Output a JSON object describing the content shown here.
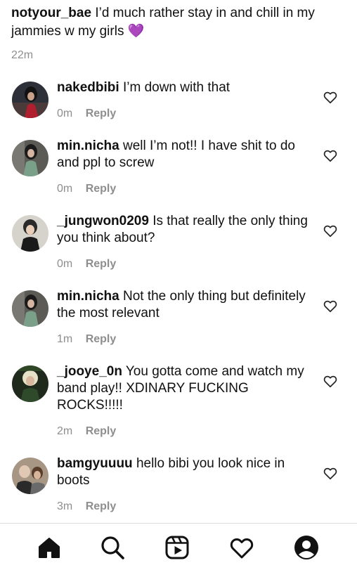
{
  "parent_comment": {
    "username": "notyour_bae",
    "text": "I’d much rather stay in and chill in my jammies w my girls 💜",
    "time": "22m"
  },
  "comments": [
    {
      "username": "nakedbibi",
      "text": "I’m down with that",
      "time": "0m",
      "reply": "Reply"
    },
    {
      "username": "min.nicha",
      "text": "well I’m not!! I have shit to do and ppl to screw",
      "time": "0m",
      "reply": "Reply"
    },
    {
      "username": "_jungwon0209",
      "text": "Is that really the only thing you think about?",
      "time": "0m",
      "reply": "Reply"
    },
    {
      "username": "min.nicha",
      "text": "Not the only thing but definitely the most relevant",
      "time": "1m",
      "reply": "Reply"
    },
    {
      "username": "_jooye_0n",
      "text": "You gotta come and watch my band play!! XDINARY FUCKING ROCKS!!!!!",
      "time": "2m",
      "reply": "Reply"
    },
    {
      "username": "bamgyuuuu",
      "text": "hello bibi you look nice in boots",
      "time": "3m",
      "reply": "Reply"
    }
  ],
  "bottom_nav": {
    "items": [
      "home-icon",
      "search-icon",
      "reels-icon",
      "heart-icon",
      "profile-icon"
    ]
  },
  "colors": {
    "text": "#111111",
    "meta": "#8e8e8e",
    "divider": "#dbdbdb",
    "background": "#ffffff"
  }
}
